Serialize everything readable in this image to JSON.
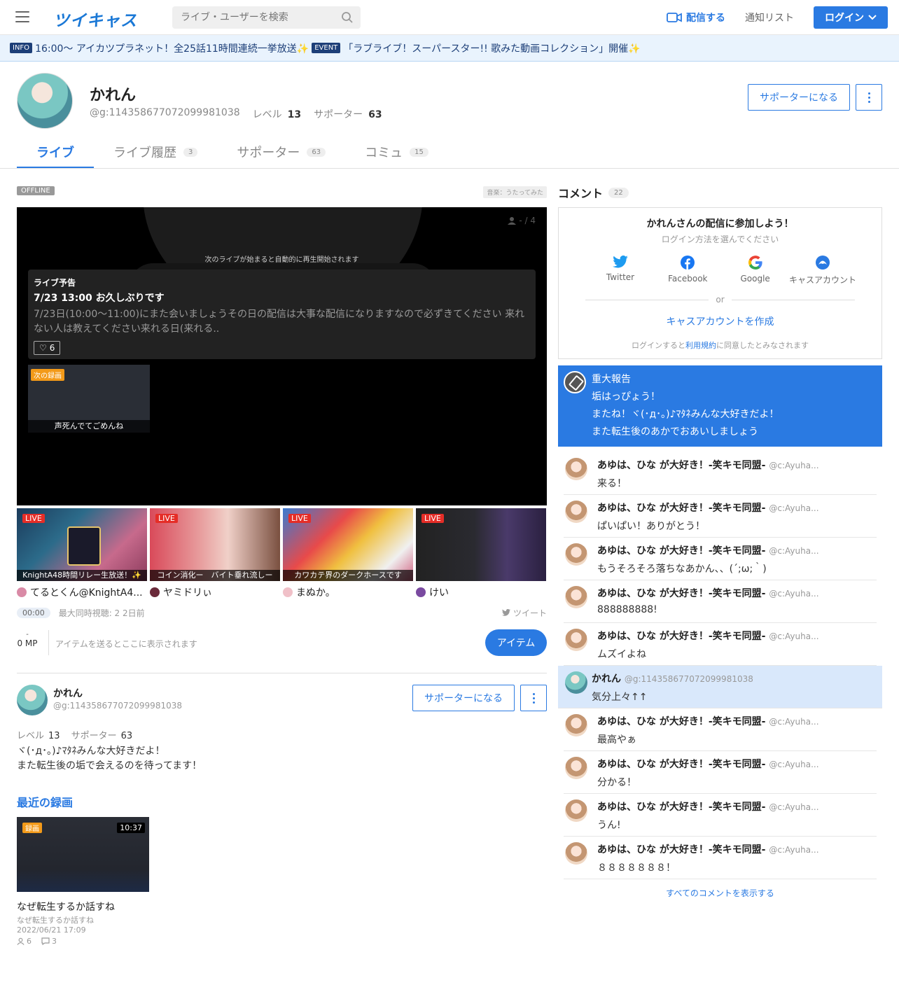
{
  "header": {
    "logo": "ツイキャス",
    "search_placeholder": "ライブ・ユーザーを検索",
    "broadcast": "配信する",
    "notify": "通知リスト",
    "login": "ログイン"
  },
  "infobar": {
    "items": [
      {
        "tag": "INFO",
        "text": "16:00〜 アイカツプラネット！全25話11時間連続一挙放送✨"
      },
      {
        "tag": "EVENT",
        "text": "「ラブライブ！スーパースター!! 歌みた動画コレクション」開催✨"
      }
    ]
  },
  "profile": {
    "name": "かれん",
    "id": "@g:114358677072099981038",
    "level_label": "レベル",
    "level": "13",
    "supporter_label": "サポーター",
    "supporters": "63",
    "become_supporter": "サポーターになる"
  },
  "tabs": [
    {
      "label": "ライブ",
      "count": ""
    },
    {
      "label": "ライブ履歴",
      "count": "3"
    },
    {
      "label": "サポーター",
      "count": "63"
    },
    {
      "label": "コミュ",
      "count": "15"
    }
  ],
  "player": {
    "status": "OFFLINE",
    "genre": "音楽：うたってみた",
    "viewers": "- / 4",
    "autoplay": "次のライブが始まると自動的に再生開始されます",
    "preview_label": "ライブ予告",
    "preview_title": "7/23 13:00  お久しぶりです",
    "preview_desc": "7/23日(10:00～11:00)にまた会いましょうその日の配信は大事な配信になりますなので必ずきてください 来れない人は教えてください来れる日(来れる..",
    "likes": "6",
    "next_rec_label": "次の録画",
    "next_rec_title": "声死んでてごめんね"
  },
  "thumbs": [
    {
      "title": "KnightA48時間リレー生放送！✨",
      "user": "てるとくん@KnightA4...",
      "live": "LIVE"
    },
    {
      "title": "コイン消化ー　バイト垂れ流しー",
      "user": "ヤミドリぃ",
      "live": "LIVE"
    },
    {
      "title": "カワカテ界のダークホースです",
      "user": "まぬか。",
      "live": "LIVE"
    },
    {
      "title": "",
      "user": "けい",
      "live": "LIVE"
    }
  ],
  "stats": {
    "time": "00:00",
    "text": "最大同時視聴: 2  2日前",
    "tweet": "ツイート"
  },
  "items": {
    "mp_dash": "-",
    "mp": "0 MP",
    "placeholder": "アイテムを送るとここに表示されます",
    "button": "アイテム"
  },
  "card": {
    "name": "かれん",
    "id": "@g:114358677072099981038",
    "level_label": "レベル",
    "level": "13",
    "supporter_label": "サポーター",
    "supporters": "63",
    "bio1": "ヾ(･д･｡)♪ﾏﾀﾈみんな大好きだよ！",
    "bio2": "また転生後の垢で会えるのを待ってます！",
    "become_supporter": "サポーターになる"
  },
  "recent": {
    "heading": "最近の録画",
    "label": "録画",
    "duration": "10:37",
    "title": "なぜ転生するか話すね",
    "subtitle": "なぜ転生するか話すね",
    "date": "2022/06/21 17:09",
    "views": "6",
    "comments": "3"
  },
  "comment_panel": {
    "heading": "コメント",
    "count": "22",
    "login_title": "かれんさんの配信に参加しよう！",
    "login_sub": "ログイン方法を選んでください",
    "providers": [
      "Twitter",
      "Facebook",
      "Google",
      "キャスアカウント"
    ],
    "or": "or",
    "create": "キャスアカウントを作成",
    "note_pre": "ログインすると",
    "note_link": "利用規約",
    "note_post": "に同意したとみなされます",
    "pinned": [
      "重大報告",
      "垢はっぴょう！",
      "またね！ヾ(･д･｡)♪ﾏﾀﾈみんな大好きだよ！",
      "また転生後のあかでおあいしましょう"
    ],
    "all_comments": "すべてのコメントを表示する"
  },
  "comments": [
    {
      "name": "あゆは、ひな が大好き！-笑キモ同盟-",
      "uid": "@c:Ayuha...",
      "msg": "来る！"
    },
    {
      "name": "あゆは、ひな が大好き！-笑キモ同盟-",
      "uid": "@c:Ayuha...",
      "msg": "ぱいぱい！ありがとう！"
    },
    {
      "name": "あゆは、ひな が大好き！-笑キモ同盟-",
      "uid": "@c:Ayuha...",
      "msg": "もうそろそろ落ちなあかん、、(´;ω;｀)"
    },
    {
      "name": "あゆは、ひな が大好き！-笑キモ同盟-",
      "uid": "@c:Ayuha...",
      "msg": "888888888!"
    },
    {
      "name": "あゆは、ひな が大好き！-笑キモ同盟-",
      "uid": "@c:Ayuha...",
      "msg": "ムズイよね"
    },
    {
      "name": "かれん",
      "uid": "@g:114358677072099981038",
      "msg": "気分上々↑↑",
      "hl": true
    },
    {
      "name": "あゆは、ひな が大好き！-笑キモ同盟-",
      "uid": "@c:Ayuha...",
      "msg": "最高やぁ"
    },
    {
      "name": "あゆは、ひな が大好き！-笑キモ同盟-",
      "uid": "@c:Ayuha...",
      "msg": "分かる！"
    },
    {
      "name": "あゆは、ひな が大好き！-笑キモ同盟-",
      "uid": "@c:Ayuha...",
      "msg": "うん!"
    },
    {
      "name": "あゆは、ひな が大好き！-笑キモ同盟-",
      "uid": "@c:Ayuha...",
      "msg": "８８８８８８８！"
    }
  ],
  "colors": {
    "accent": "#2a7ae2",
    "live": "#e52d27",
    "record": "#f39a19"
  }
}
